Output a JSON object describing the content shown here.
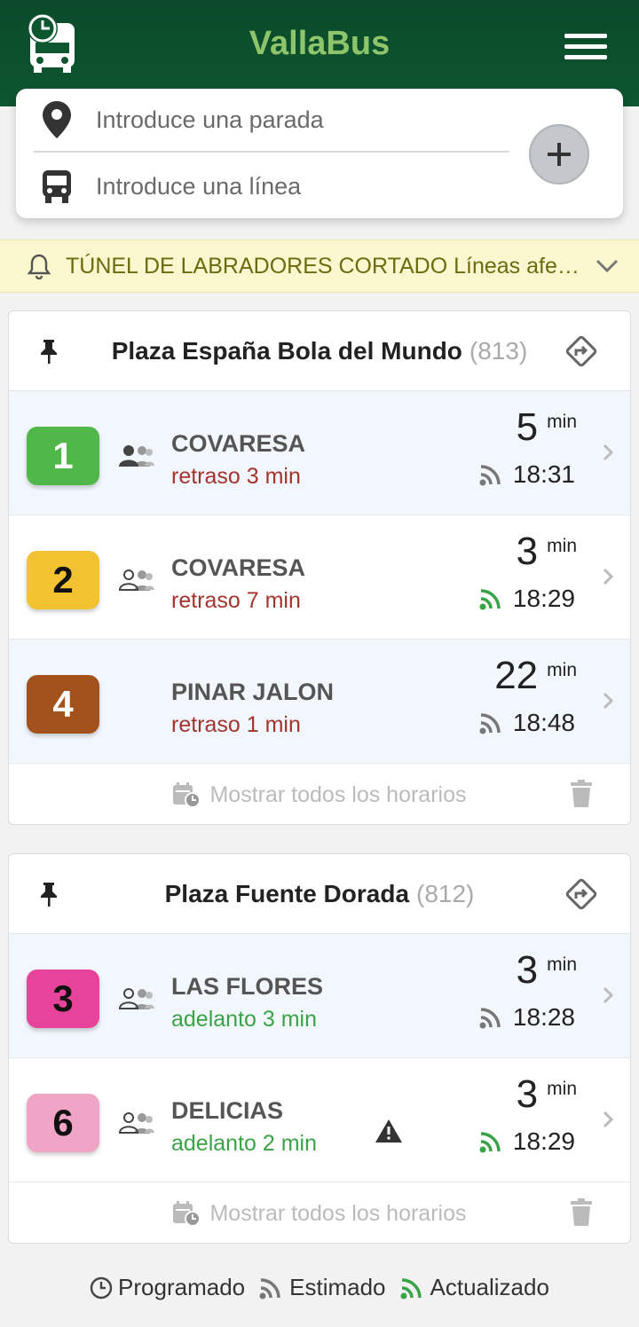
{
  "app": {
    "title": "VallaBus"
  },
  "search": {
    "stop_placeholder": "Introduce una parada",
    "line_placeholder": "Introduce una línea",
    "add_icon": "plus-icon"
  },
  "alert": {
    "text": "TÚNEL DE LABRADORES CORTADO Líneas afectadas"
  },
  "colors": {
    "header": "#0d5630",
    "title": "#8fc56a",
    "late": "#a3332c",
    "early": "#3aa347",
    "realtime": "#3aa347",
    "estimated": "#777777"
  },
  "stops": [
    {
      "name": "Plaza España Bola del Mundo",
      "code": "(813)",
      "show_all_label": "Mostrar todos los horarios",
      "arrivals": [
        {
          "line": "1",
          "line_color": "#4fb848",
          "line_text_color": "#ffffff",
          "destination": "COVARESA",
          "delay": "retraso 3 min",
          "minutes": "5",
          "min_unit": "min",
          "time": "18:31",
          "signal": "estimated"
        },
        {
          "line": "2",
          "line_color": "#f2c230",
          "line_text_color": "#111111",
          "destination": "COVARESA",
          "delay": "retraso 7 min",
          "minutes": "3",
          "min_unit": "min",
          "time": "18:29",
          "signal": "realtime"
        },
        {
          "line": "4",
          "line_color": "#a4521c",
          "line_text_color": "#ffffff",
          "destination": "PINAR JALON",
          "delay": "retraso 1 min",
          "minutes": "22",
          "min_unit": "min",
          "time": "18:48",
          "signal": "estimated"
        }
      ]
    },
    {
      "name": "Plaza Fuente Dorada",
      "code": "(812)",
      "show_all_label": "Mostrar todos los horarios",
      "arrivals": [
        {
          "line": "3",
          "line_color": "#e8439a",
          "line_text_color": "#111111",
          "destination": "LAS FLORES",
          "delay": "adelanto 3 min",
          "minutes": "3",
          "min_unit": "min",
          "time": "18:28",
          "signal": "estimated"
        },
        {
          "line": "6",
          "line_color": "#f0a4c6",
          "line_text_color": "#111111",
          "destination": "DELICIAS",
          "delay": "adelanto 2 min",
          "minutes": "3",
          "min_unit": "min",
          "time": "18:29",
          "signal": "realtime"
        }
      ]
    }
  ],
  "legend": {
    "scheduled": "Programado",
    "estimated": "Estimado",
    "updated": "Actualizado"
  }
}
